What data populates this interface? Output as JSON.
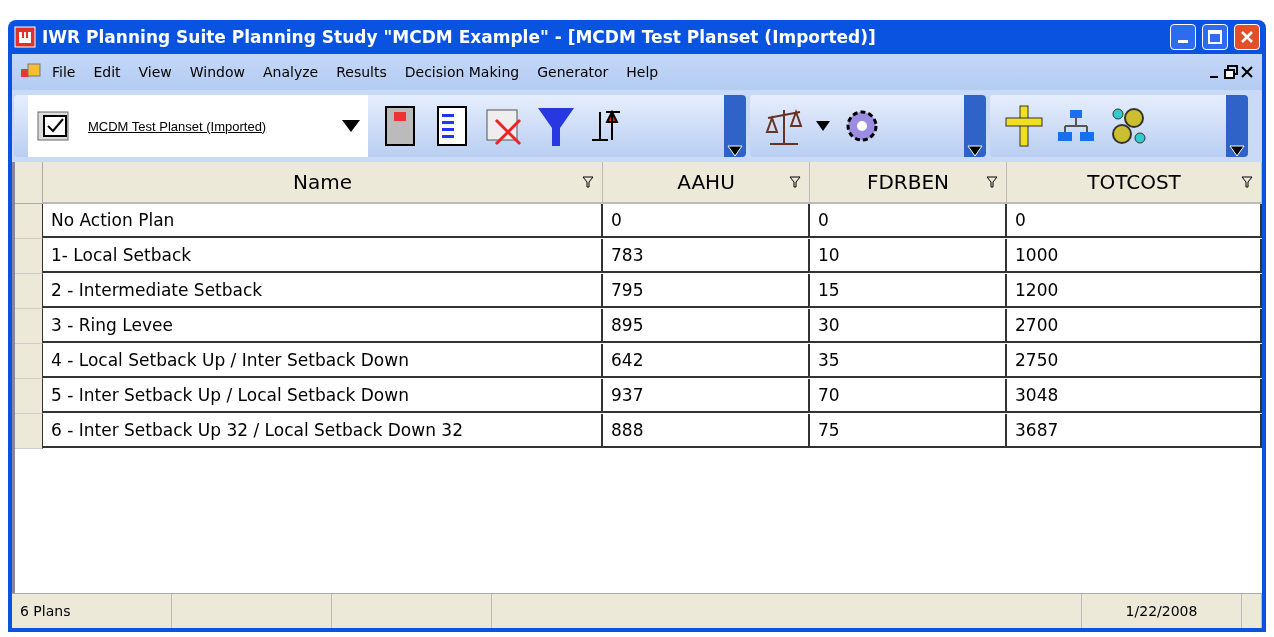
{
  "window": {
    "title": "IWR Planning Suite Planning Study \"MCDM Example\" - [MCDM Test Planset (Imported)]"
  },
  "menu": [
    "File",
    "Edit",
    "View",
    "Window",
    "Analyze",
    "Results",
    "Decision Making",
    "Generator",
    "Help"
  ],
  "toolbar": {
    "planset": "MCDM Test Planset (Imported)"
  },
  "table": {
    "columns": [
      "Name",
      "AAHU",
      "FDRBEN",
      "TOTCOST"
    ],
    "rows": [
      [
        "No Action Plan",
        "0",
        "0",
        "0"
      ],
      [
        "1- Local Setback",
        "783",
        "10",
        "1000"
      ],
      [
        "2 - Intermediate Setback",
        "795",
        "15",
        "1200"
      ],
      [
        "3 - Ring Levee",
        "895",
        "30",
        "2700"
      ],
      [
        "4 - Local Setback Up / Inter Setback Down",
        "642",
        "35",
        "2750"
      ],
      [
        "5 - Inter Setback Up / Local Setback Down",
        "937",
        "70",
        "3048"
      ],
      [
        "6 - Inter Setback Up 32 / Local Setback Down 32",
        "888",
        "75",
        "3687"
      ]
    ]
  },
  "status_bar": {
    "count": "6 Plans",
    "date": "1/22/2008"
  }
}
